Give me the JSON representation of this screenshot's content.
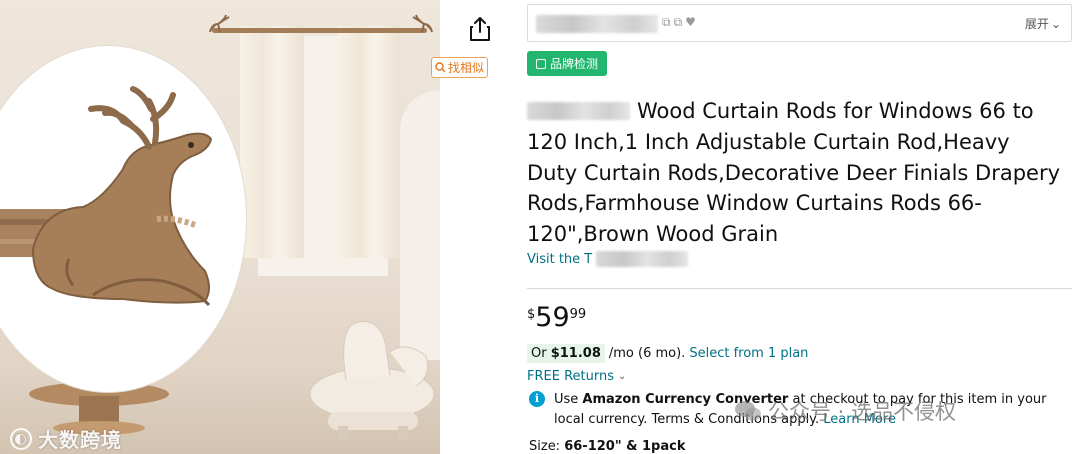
{
  "share": {
    "icon": "share-icon"
  },
  "find_similar": {
    "label": "找相似",
    "icon": "search-icon"
  },
  "top_bar": {
    "expand_label": "展开",
    "icons": [
      "copy-icon",
      "copy-icon",
      "heart-icon"
    ]
  },
  "brand_check": {
    "label": "品牌检测"
  },
  "product": {
    "title": "Wood Curtain Rods for Windows 66 to 120 Inch,1 Inch Adjustable Curtain Rod,Heavy Duty Curtain Rods,Decorative Deer Finials Drapery Rods,Farmhouse Window Curtains Rods 66-120\",Brown Wood Grain",
    "visit_store_label": "Visit the T"
  },
  "price": {
    "symbol": "$",
    "whole": "59",
    "fraction": "99"
  },
  "financing": {
    "prefix": "Or",
    "amount": "$11.08",
    "term": "/mo (6 mo).",
    "plan_link": "Select from 1 plan"
  },
  "returns": {
    "label": "FREE Returns"
  },
  "currency_notice": {
    "before": "Use ",
    "bold": "Amazon Currency Converter",
    "after": " at checkout to pay for this item in your local currency. Terms & Conditions apply. ",
    "link": "Learn More"
  },
  "size": {
    "label": "Size:",
    "value": "66-120\" & 1pack"
  },
  "watermarks": {
    "left": "大数跨境",
    "right": "公众号 · 选品不侵权"
  },
  "colors": {
    "link": "#007185",
    "brand_check": "#21b56e",
    "find_similar": "#e2761b",
    "info": "#00a0d2"
  }
}
